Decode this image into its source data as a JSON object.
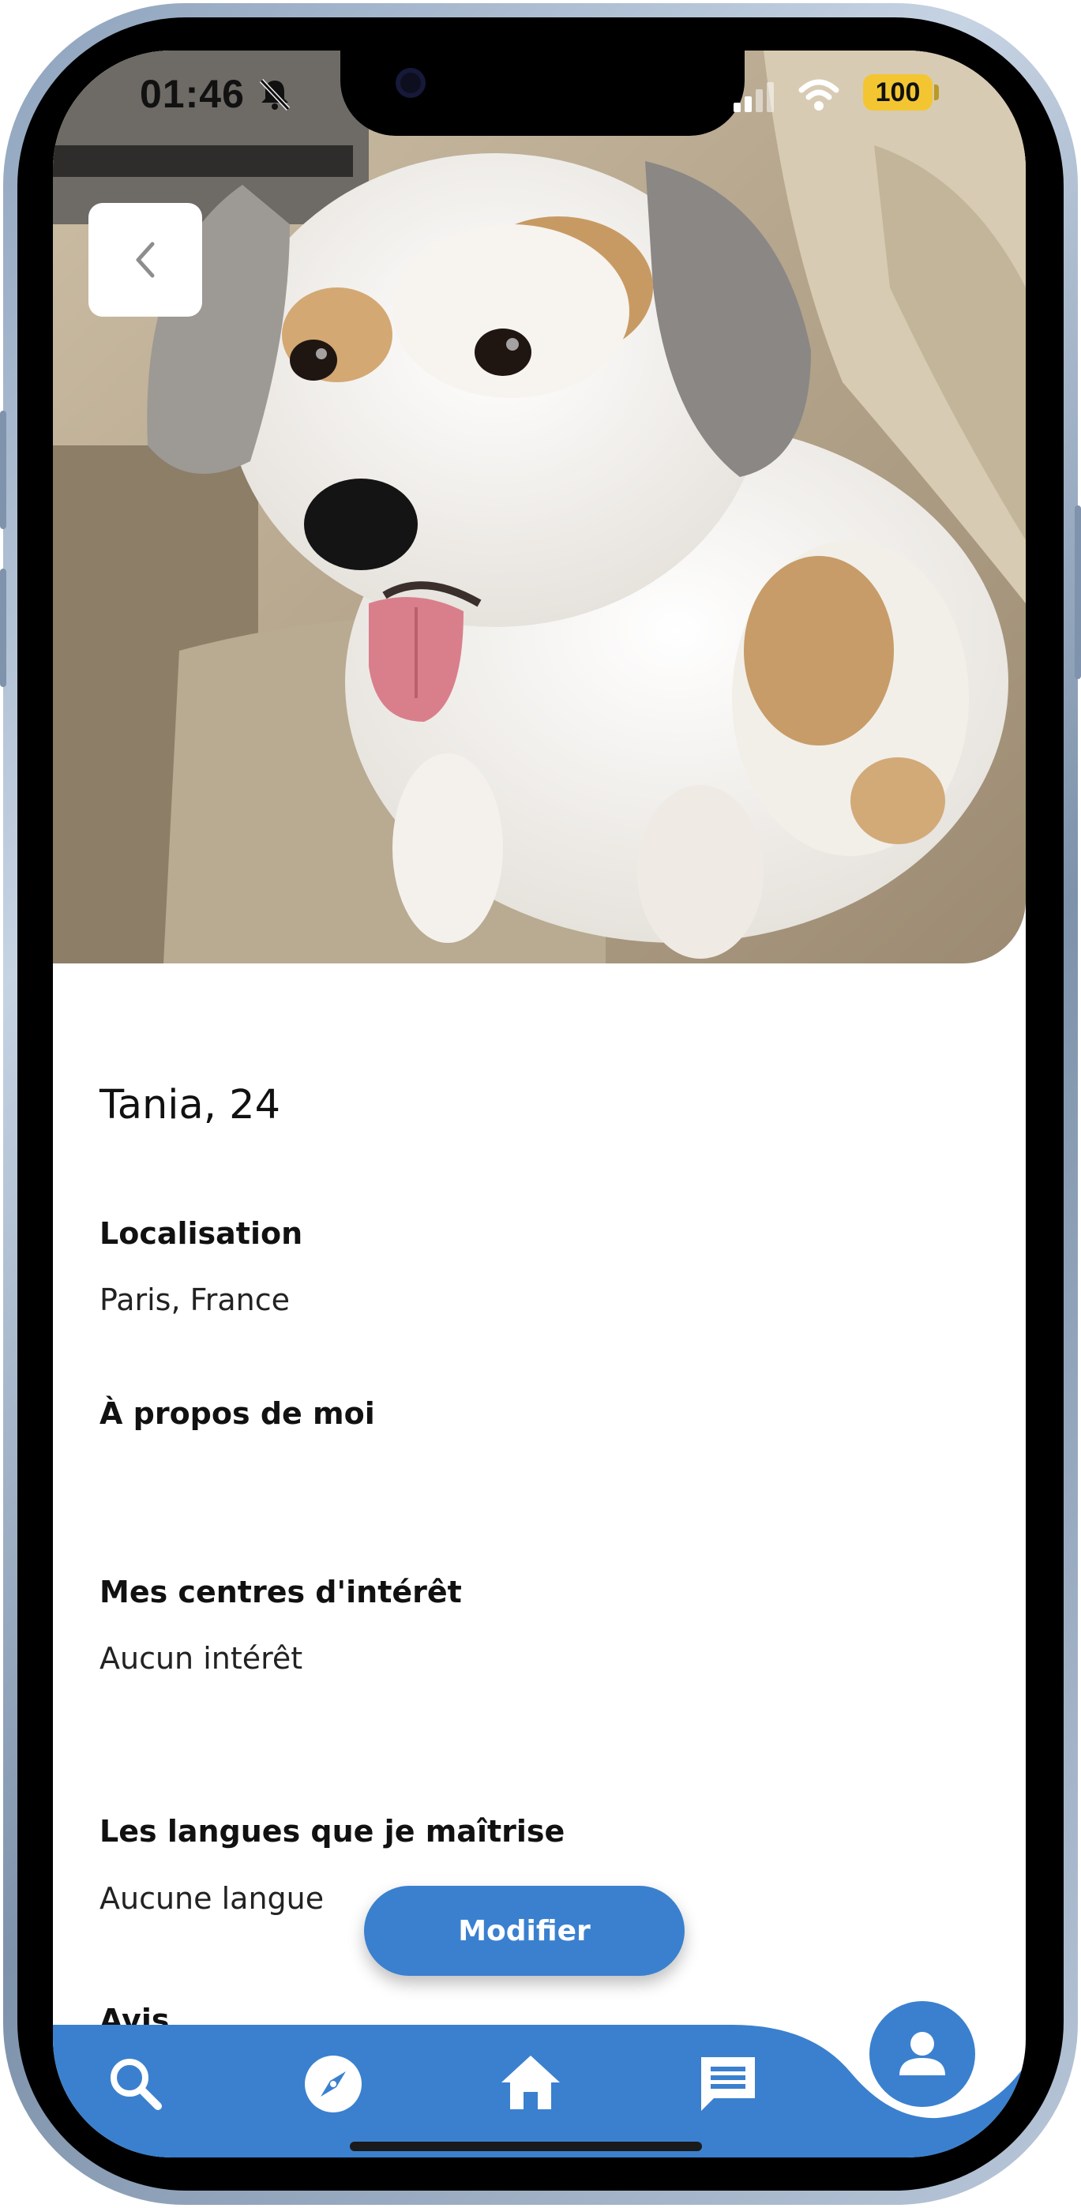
{
  "status_bar": {
    "time": "01:46",
    "battery": "100"
  },
  "profile": {
    "name_age": "Tania, 24",
    "sections": {
      "location_label": "Localisation",
      "location_value": "Paris, France",
      "about_label": "À propos de moi",
      "about_value": "",
      "interests_label": "Mes centres d'intérêt",
      "interests_value": "Aucun intérêt",
      "languages_label": "Les langues que je maîtrise",
      "languages_value": "Aucune langue",
      "reviews_label": "Avis"
    }
  },
  "actions": {
    "modify_label": "Modifier"
  },
  "nav": {
    "items": [
      "search-icon",
      "compass-icon",
      "home-icon",
      "chat-icon",
      "profile-icon"
    ],
    "active": "profile-icon"
  },
  "colors": {
    "accent": "#3a80cf",
    "battery": "#f3c631"
  }
}
